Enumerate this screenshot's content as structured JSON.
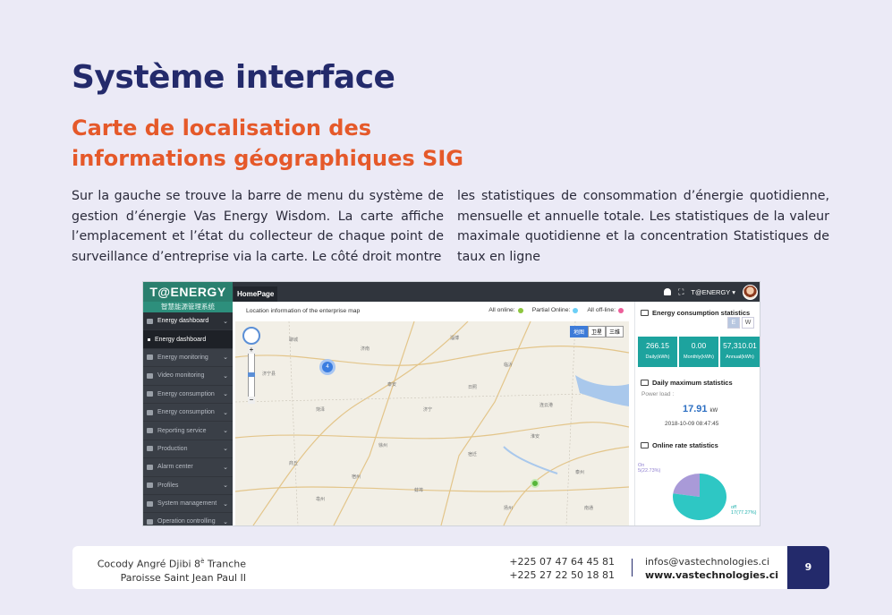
{
  "heading": {
    "title": "Système interface",
    "subtitle": "Carte de localisation des informations géographiques SIG"
  },
  "body": {
    "col_left": "Sur la gauche se trouve la barre de menu du système de gestion d’énergie Vas Energy Wisdom. La carte affiche l’emplacement et l’état du collecteur de chaque point de surveillance d’entreprise via la carte. Le côté droit montre",
    "col_right": "les statistiques de consommation d’énergie quotidienne, mensuelle et annuelle totale. Les statistiques de la valeur maximale quotidienne et la concentration Statistiques de taux en ligne"
  },
  "screenshot": {
    "brand": "T@ENERGY",
    "brand_sub": "智慧能源管理系统",
    "home_tab": "HomePage",
    "user": "T@ENERGY ▾",
    "sidebar": [
      {
        "label": "Energy dashboard",
        "type": "head"
      },
      {
        "label": "Energy dashboard",
        "type": "sub"
      },
      {
        "label": "Energy monitoring",
        "type": "item"
      },
      {
        "label": "Video monitoring",
        "type": "item"
      },
      {
        "label": "Energy consumption",
        "type": "item"
      },
      {
        "label": "Energy consumption",
        "type": "item"
      },
      {
        "label": "Reporting service",
        "type": "item"
      },
      {
        "label": "Production",
        "type": "item"
      },
      {
        "label": "Alarm center",
        "type": "item"
      },
      {
        "label": "Profiles",
        "type": "item"
      },
      {
        "label": "System management",
        "type": "item"
      },
      {
        "label": "Operation controlling",
        "type": "item"
      }
    ],
    "map": {
      "title": "Location information of the enterprise map",
      "legend": [
        {
          "label": "All online:",
          "color": "#8dc63f"
        },
        {
          "label": "Partial Online:",
          "color": "#6ccff6"
        },
        {
          "label": "All off-line:",
          "color": "#ec5f9a"
        }
      ],
      "map_types": [
        "地图",
        "卫星",
        "三维"
      ],
      "cluster_count": "4"
    },
    "energy": {
      "title": "Energy consumption statistics",
      "toggles": [
        "E",
        "W"
      ],
      "stats": [
        {
          "value": "266.15",
          "label": "Daily(kWh)"
        },
        {
          "value": "0.00",
          "label": "Monthly(kWh)"
        },
        {
          "value": "57,310.01",
          "label": "Annual(kWh)"
        }
      ]
    },
    "daily_max": {
      "title": "Daily maximum statistics",
      "power_label": "Power load :",
      "value": "17.91",
      "unit": "kW",
      "timestamp": "2018-10-09 08:47:45"
    },
    "online_rate": {
      "title": "Online rate statistics",
      "slices": [
        {
          "label": "On",
          "value": "5(22.73%)",
          "percent": 22.73,
          "color": "#a99ad8"
        },
        {
          "label": "off",
          "value": "17(77.27%)",
          "percent": 77.27,
          "color": "#2ec7c4"
        }
      ]
    }
  },
  "footer": {
    "address_line1": "Cocody Angré Djibi 8",
    "address_sup": "è",
    "address_line1_end": " Tranche",
    "address_line2": "Paroisse Saint Jean Paul II",
    "phone1": "+225 07 47 64 45 81",
    "phone2": "+225 27 22 50 18 81",
    "email": "infos@vastechnologies.ci",
    "website": "www.vastechnologies.ci",
    "page": "9"
  }
}
